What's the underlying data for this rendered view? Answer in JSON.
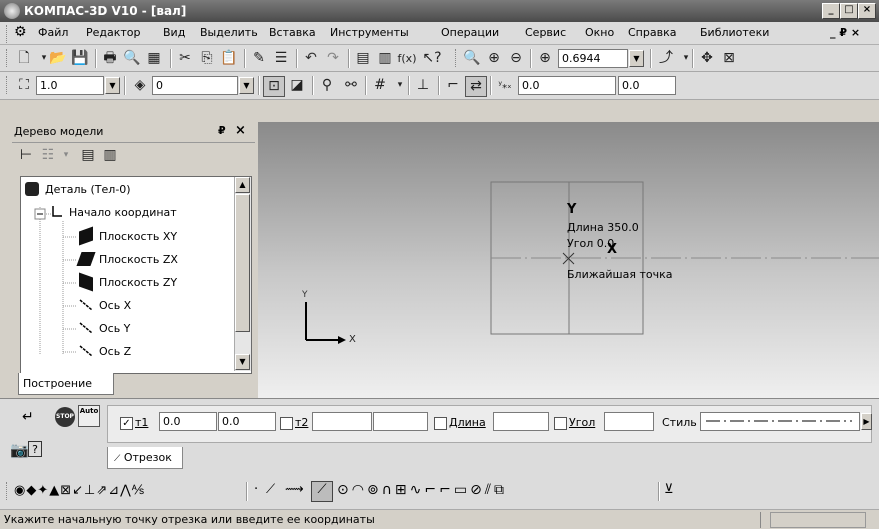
{
  "window": {
    "title": "КОМПАС-3D V10 - [вал]",
    "btn_min": "_",
    "btn_max": "□",
    "btn_close": "×"
  },
  "menu": {
    "items": [
      "Файл",
      "Редактор",
      "Вид",
      "Выделить",
      "Вставка",
      "Инструменты",
      "Операции",
      "Сервис",
      "Окно",
      "Справка",
      "Библиотеки"
    ],
    "right": "_ ₽ ×"
  },
  "toolbar2": {
    "zoom_value": "0.6944"
  },
  "toolbar3": {
    "scale_value": "1.0",
    "layer_value": "0",
    "x_value": "0.0",
    "y_value": "0.0"
  },
  "tree_panel": {
    "title": "Дерево модели",
    "pin": "₽",
    "close": "×",
    "items": [
      {
        "label": "Деталь (Тел-0)",
        "icon": "part-icon"
      },
      {
        "label": "Начало координат",
        "icon": "origin-icon"
      },
      {
        "label": "Плоскость XY",
        "icon": "plane-icon"
      },
      {
        "label": "Плоскость ZX",
        "icon": "plane-icon"
      },
      {
        "label": "Плоскость ZY",
        "icon": "plane-icon"
      },
      {
        "label": "Ось X",
        "icon": "axis-icon"
      },
      {
        "label": "Ось Y",
        "icon": "axis-icon"
      },
      {
        "label": "Ось Z",
        "icon": "axis-icon"
      }
    ],
    "tab": "Построение"
  },
  "viewport": {
    "axis_y": "Y",
    "axis_x": "X",
    "hint_y": "Y",
    "hint_length": "Длина 350.0",
    "hint_angle": "Угол 0.0",
    "hint_x": "X",
    "hint_nearest": "Ближайшая точка"
  },
  "props": {
    "t1_label": "т1",
    "t1_x": "0.0",
    "t1_y": "0.0",
    "t2_label": "т2",
    "t2_x": "",
    "t2_y": "",
    "length_label": "Длина",
    "length_value": "",
    "angle_label": "Угол",
    "angle_value": "",
    "style_label": "Стиль",
    "tab": "Отрезок",
    "stop": "STOP",
    "auto": "Auto"
  },
  "status": {
    "text": "Укажите начальную точку отрезка или введите ее координаты"
  }
}
